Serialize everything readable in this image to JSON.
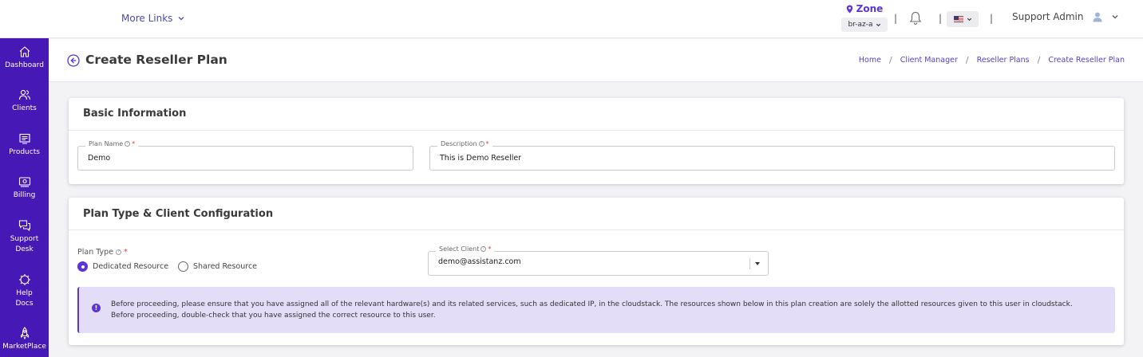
{
  "header": {
    "more_links": "More Links",
    "zone_label": "Zone",
    "zone_value": "br-az-a",
    "separator": "|",
    "language_flag": "us-flag-icon",
    "user_name": "Support Admin"
  },
  "sidebar": {
    "items": [
      {
        "label": "Dashboard",
        "icon": "home-icon"
      },
      {
        "label": "Clients",
        "icon": "users-icon"
      },
      {
        "label": "Products",
        "icon": "products-icon"
      },
      {
        "label": "Billing",
        "icon": "billing-icon"
      },
      {
        "label": "Support",
        "label2": "Desk",
        "icon": "chat-icon"
      },
      {
        "label": "Help",
        "label2": "Docs",
        "icon": "help-gear-icon"
      },
      {
        "label": "MarketPlace",
        "icon": "rocket-icon"
      }
    ]
  },
  "page": {
    "title": "Create Reseller Plan",
    "breadcrumb": [
      "Home",
      "Client Manager",
      "Reseller Plans",
      "Create Reseller Plan"
    ],
    "breadcrumb_sep": "/"
  },
  "basic_info": {
    "title": "Basic Information",
    "plan_name_label": "Plan Name",
    "plan_name_value": "Demo",
    "description_label": "Description",
    "description_value": "This is Demo Reseller",
    "required_mark": "*",
    "help_mark": "?"
  },
  "plan_config": {
    "title": "Plan Type & Client Configuration",
    "plan_type_label": "Plan Type",
    "options": [
      "Dedicated Resource",
      "Shared Resource"
    ],
    "selected_option": "Dedicated Resource",
    "select_client_label": "Select Client",
    "select_client_value": "demo@assistanz.com",
    "alert_icon": "!",
    "alert_text": "Before proceeding, please ensure that you have assigned all of the relevant hardware(s) and its related services, such as dedicated IP, in the cloudstack. The resources shown below in this plan creation are solely the allotted resources given to this user in cloudstack. Before proceeding, double-check that you have assigned the correct resource to this user."
  },
  "colors": {
    "brand": "#4618b6",
    "accent": "#5b35d5",
    "alert_bg": "#e4ddf7"
  }
}
